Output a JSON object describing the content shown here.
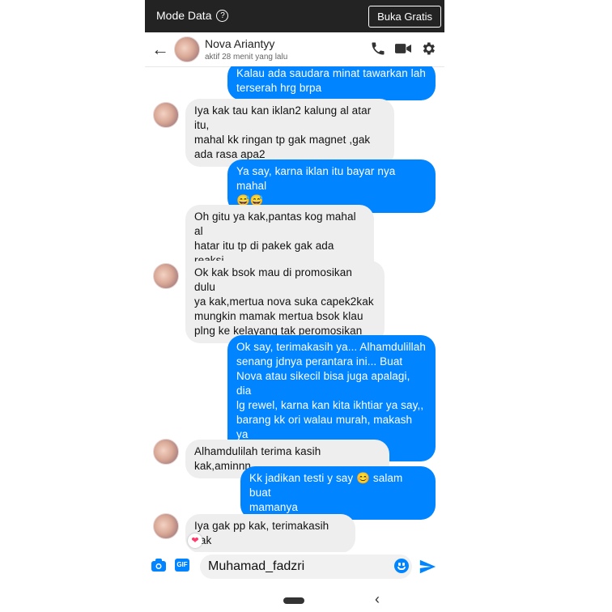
{
  "topbar": {
    "mode_label": "Mode Data",
    "help_icon": "?",
    "cta_label": "Buka Gratis"
  },
  "header": {
    "back_icon": "←",
    "name": "Nova Ariantyy",
    "status": "aktif 28 menit yang lalu"
  },
  "messages": [
    {
      "side": "out",
      "text": "Kalau ada saudara minat tawarkan lah\nterserah hrg brpa"
    },
    {
      "side": "in",
      "text": "Iya kak tau kan iklan2 kalung al atar itu,\nmahal kk ringan tp gak magnet ,gak\nada rasa apa2"
    },
    {
      "side": "out",
      "text": "Ya say, karna iklan itu bayar nya mahal\n😅😅"
    },
    {
      "side": "in",
      "text": "Oh gitu ya kak,pantas kog mahal al\nhatar itu tp di pakek gak ada reaksi\nsedikit pun"
    },
    {
      "side": "in",
      "text": "Ok kak bsok mau di promosikan dulu\nya kak,mertua nova suka capek2kak\nmungkin mamak mertua bsok klau\nplng ke kelayang tak peromosikan"
    },
    {
      "side": "out",
      "text": "Ok say, terimakasih ya... Alhamdulillah\nsenang jdnya perantara ini... Buat\nNova atau sikecil bisa juga apalagi, dia\nlg rewel, karna kan kita ikhtiar ya say,,\nbarang kk ori walau murah, makash ya\nmurah rezeki"
    },
    {
      "side": "in",
      "text": "Alhamdulilah terima kasih kak,aminnn"
    },
    {
      "side": "out",
      "text": "Kk jadikan testi y say 😊 salam buat\nmamanya"
    },
    {
      "side": "in",
      "text": "Iya gak pp kak, terimakasih kak"
    }
  ],
  "reaction": "❤",
  "composer": {
    "gif_label": "GIF",
    "input_value": "Muhamad_fadzri"
  },
  "navbar": {
    "back_icon": "‹"
  },
  "colors": {
    "accent": "#0084ff",
    "incoming_bubble": "#eeeeee",
    "topbar": "#232323"
  }
}
